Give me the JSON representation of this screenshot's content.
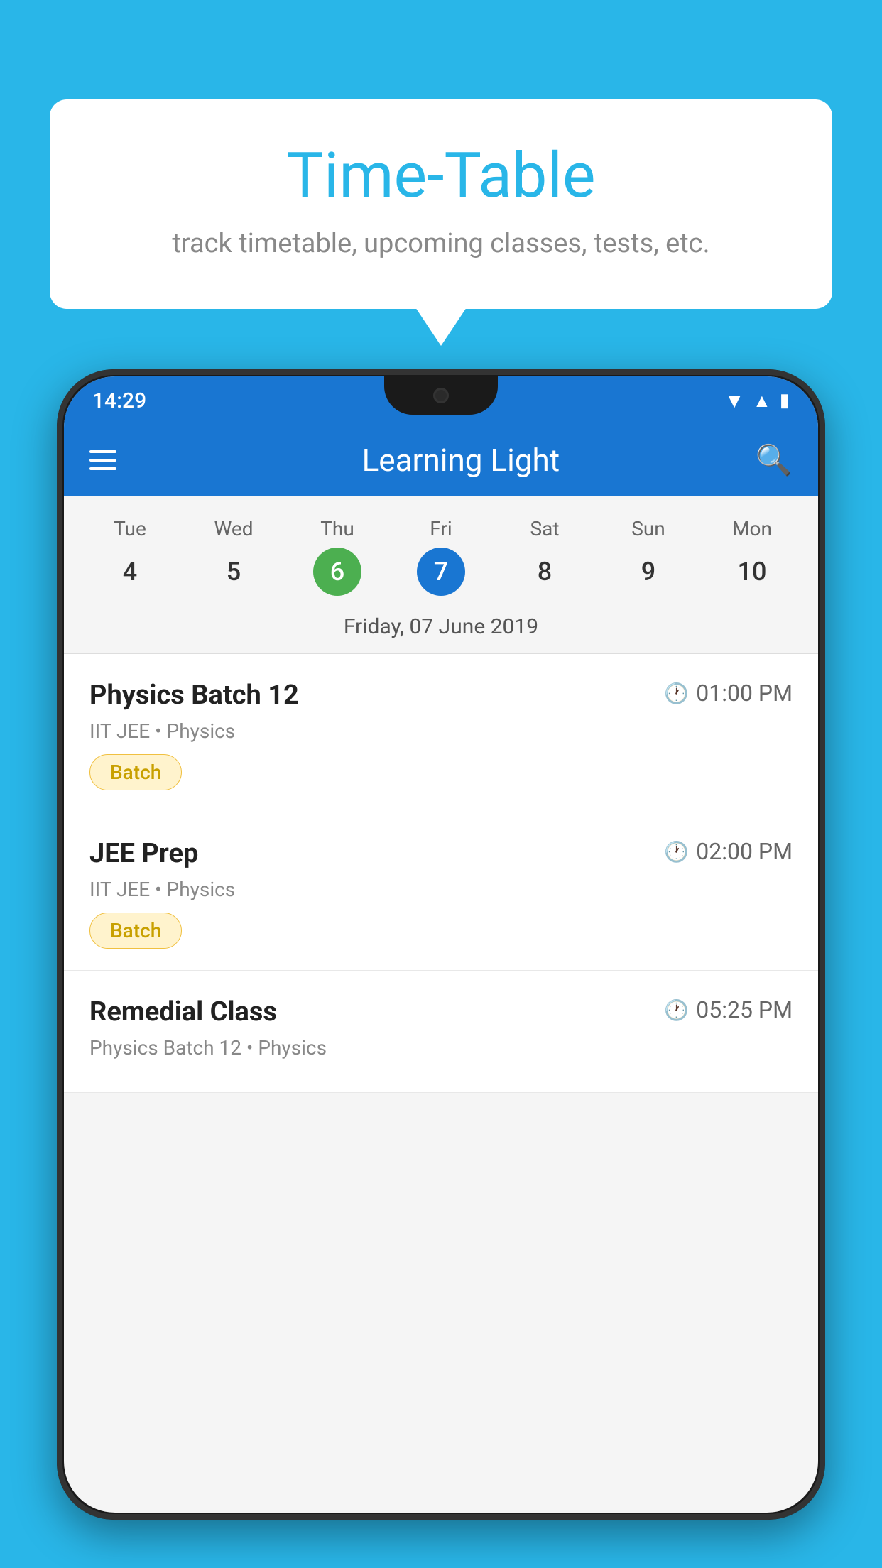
{
  "background_color": "#29b6e8",
  "speech_bubble": {
    "title": "Time-Table",
    "subtitle": "track timetable, upcoming classes, tests, etc."
  },
  "phone": {
    "status_bar": {
      "time": "14:29"
    },
    "app_bar": {
      "title": "Learning Light"
    },
    "calendar": {
      "days": [
        {
          "label": "Tue",
          "number": "4",
          "state": "normal"
        },
        {
          "label": "Wed",
          "number": "5",
          "state": "normal"
        },
        {
          "label": "Thu",
          "number": "6",
          "state": "today"
        },
        {
          "label": "Fri",
          "number": "7",
          "state": "selected"
        },
        {
          "label": "Sat",
          "number": "8",
          "state": "normal"
        },
        {
          "label": "Sun",
          "number": "9",
          "state": "normal"
        },
        {
          "label": "Mon",
          "number": "10",
          "state": "normal"
        }
      ],
      "selected_date_label": "Friday, 07 June 2019"
    },
    "schedule": [
      {
        "title": "Physics Batch 12",
        "time": "01:00 PM",
        "subtitle": "IIT JEE • Physics",
        "badge": "Batch"
      },
      {
        "title": "JEE Prep",
        "time": "02:00 PM",
        "subtitle": "IIT JEE • Physics",
        "badge": "Batch"
      },
      {
        "title": "Remedial Class",
        "time": "05:25 PM",
        "subtitle": "Physics Batch 12 • Physics",
        "badge": null
      }
    ]
  }
}
